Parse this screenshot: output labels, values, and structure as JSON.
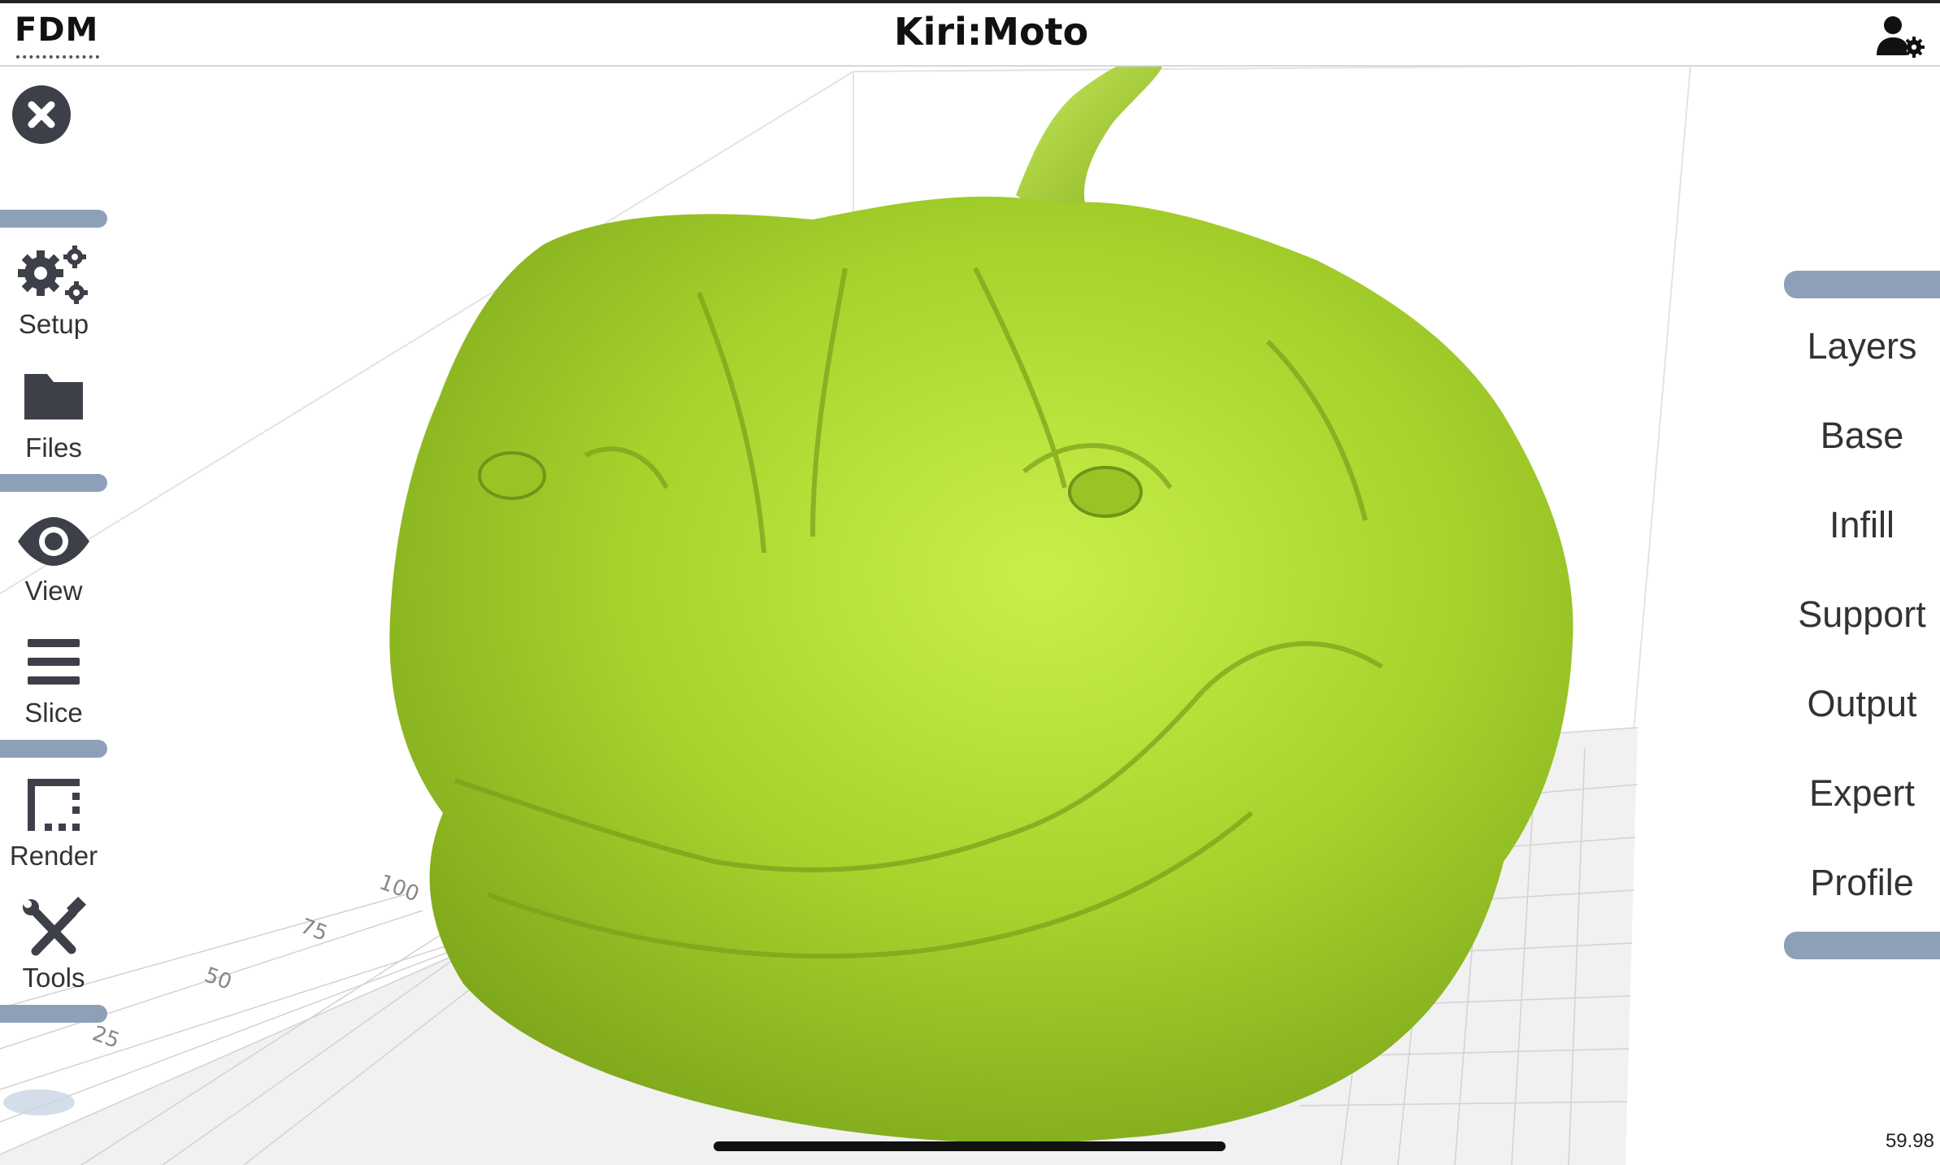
{
  "header": {
    "mode": "FDM",
    "title": "Kiri:Moto"
  },
  "left_toolbar": {
    "items": [
      {
        "label": "Setup",
        "icon": "gears-icon"
      },
      {
        "label": "Files",
        "icon": "folder-icon"
      },
      {
        "label": "View",
        "icon": "eye-icon"
      },
      {
        "label": "Slice",
        "icon": "bars-icon"
      },
      {
        "label": "Render",
        "icon": "dashed-square-icon"
      },
      {
        "label": "Tools",
        "icon": "tools-icon"
      }
    ]
  },
  "right_menu": {
    "items": [
      "Layers",
      "Base",
      "Infill",
      "Support",
      "Output",
      "Expert",
      "Profile"
    ]
  },
  "viewport": {
    "grid_labels": [
      "100",
      "75",
      "50",
      "25"
    ],
    "model_color": "#a6d22c",
    "grid_color": "#d5d5d5"
  },
  "status": {
    "fps": "59.98"
  },
  "colors": {
    "divider": "#8da0b8",
    "icon_dark": "#3d4049"
  }
}
